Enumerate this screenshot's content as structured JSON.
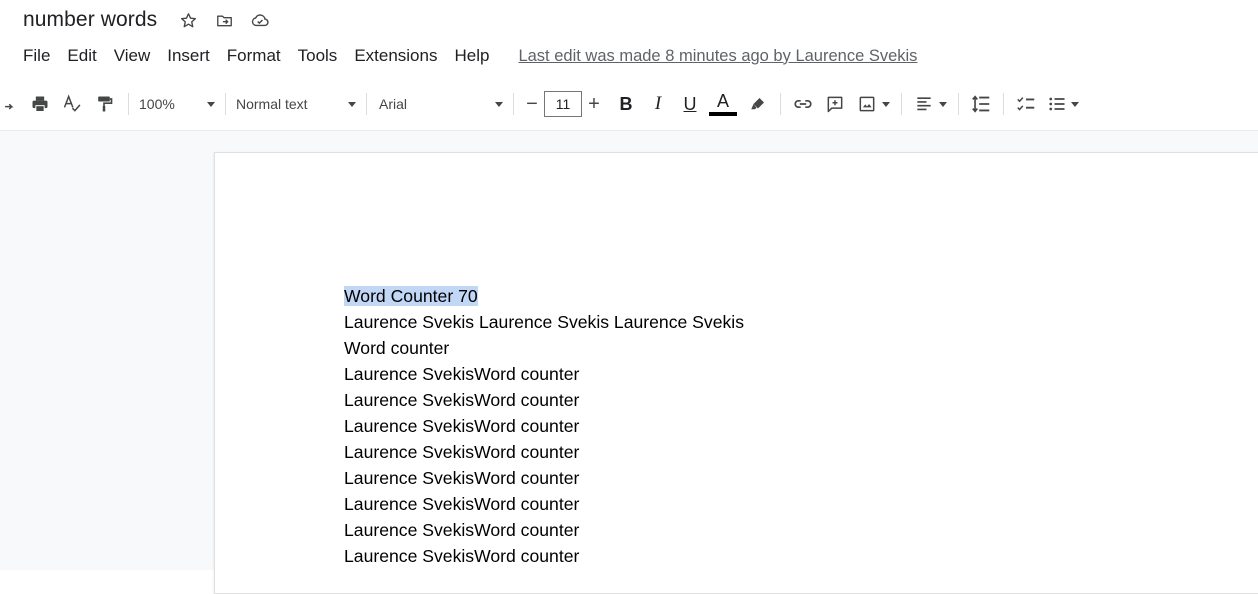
{
  "title_bar": {
    "doc_title": "number words",
    "icons": [
      "star-icon",
      "move-to-folder-icon",
      "cloud-saved-icon"
    ]
  },
  "menu": {
    "items": [
      "File",
      "Edit",
      "View",
      "Insert",
      "Format",
      "Tools",
      "Extensions",
      "Help"
    ],
    "last_edit": "Last edit was made 8 minutes ago by Laurence Svekis"
  },
  "toolbar": {
    "zoom": "100%",
    "style": "Normal text",
    "font": "Arial",
    "font_size": "11",
    "minus": "−",
    "plus": "+",
    "bold": "B",
    "italic": "I",
    "underline": "U",
    "text_color_letter": "A",
    "text_color": "#000000"
  },
  "document": {
    "lines": [
      "Word Counter 70",
      "Laurence Svekis Laurence Svekis Laurence Svekis",
      "Word counter",
      "Laurence SvekisWord counter",
      "Laurence SvekisWord counter",
      "Laurence SvekisWord counter",
      "Laurence SvekisWord counter",
      "Laurence SvekisWord counter",
      "Laurence SvekisWord counter",
      "Laurence SvekisWord counter",
      "Laurence SvekisWord counter"
    ],
    "selection_color": "#c2d7f6"
  }
}
